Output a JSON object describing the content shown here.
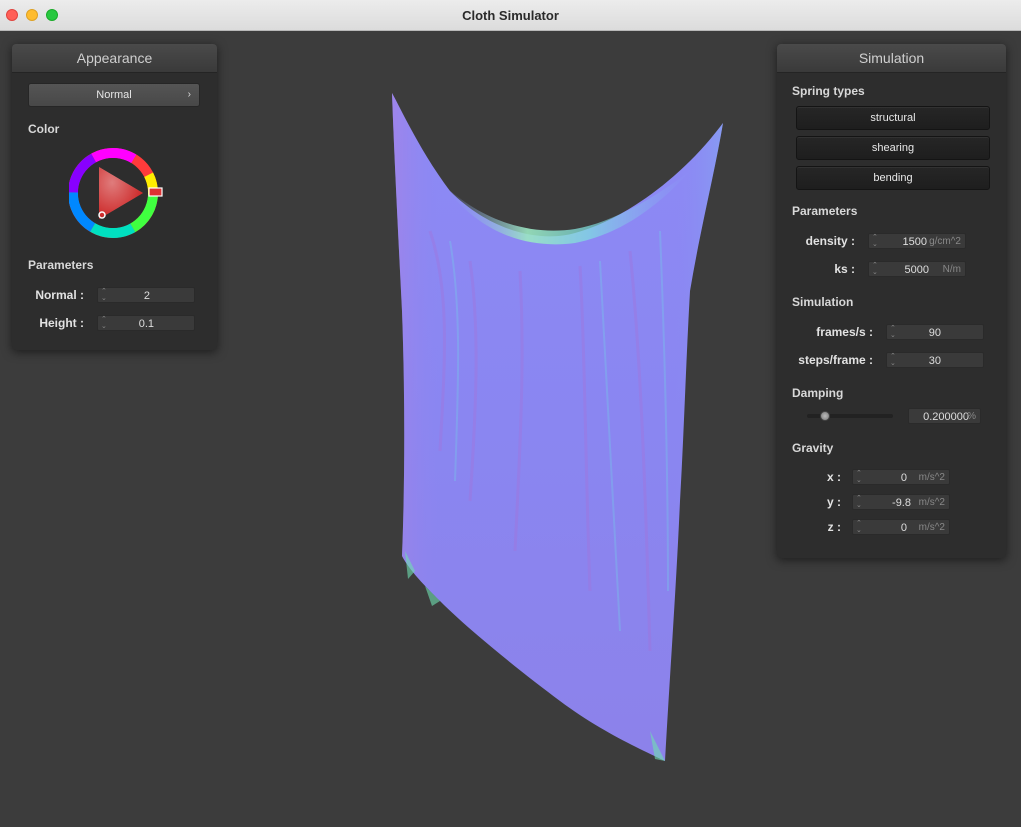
{
  "window": {
    "title": "Cloth Simulator"
  },
  "appearance": {
    "title": "Appearance",
    "shader": {
      "selected": "Normal",
      "chevron_icon": "chevron-right-icon"
    },
    "color_label": "Color",
    "color_wheel_icon": "color-wheel-icon",
    "parameters_label": "Parameters",
    "normal": {
      "label": "Normal :",
      "value": "2"
    },
    "height": {
      "label": "Height :",
      "value": "0.1"
    }
  },
  "simulation": {
    "title": "Simulation",
    "spring_types_label": "Spring types",
    "spring_types": [
      "structural",
      "shearing",
      "bending"
    ],
    "parameters_label": "Parameters",
    "density": {
      "label": "density :",
      "value": "1500",
      "unit": "g/cm^2"
    },
    "ks": {
      "label": "ks :",
      "value": "5000",
      "unit": "N/m"
    },
    "sim_label": "Simulation",
    "fps": {
      "label": "frames/s :",
      "value": "90"
    },
    "steps": {
      "label": "steps/frame :",
      "value": "30"
    },
    "damping_label": "Damping",
    "damping": {
      "value": "0.200000",
      "unit": "%",
      "slider_fraction": 0.2
    },
    "gravity_label": "Gravity",
    "gravity": [
      {
        "label": "x :",
        "value": "0",
        "unit": "m/s^2"
      },
      {
        "label": "y :",
        "value": "-9.8",
        "unit": "m/s^2"
      },
      {
        "label": "z :",
        "value": "0",
        "unit": "m/s^2"
      }
    ]
  },
  "colors": {
    "background": "#3c3c3c",
    "panel": "#2d2d2d",
    "cloth_base": "#8a86f2"
  }
}
